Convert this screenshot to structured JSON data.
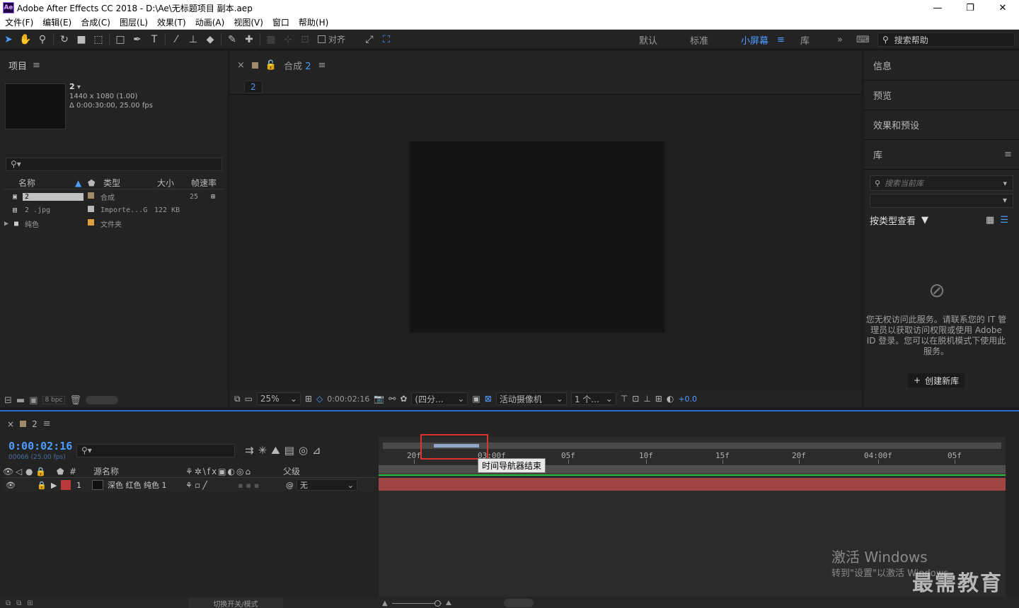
{
  "window": {
    "app_icon": "Ae",
    "title": "Adobe After Effects CC 2018 - D:\\Ae\\无标题项目 副本.aep",
    "minimize": "—",
    "maximize": "❐",
    "close": "✕"
  },
  "menu": [
    "文件(F)",
    "编辑(E)",
    "合成(C)",
    "图层(L)",
    "效果(T)",
    "动画(A)",
    "视图(V)",
    "窗口",
    "帮助(H)"
  ],
  "toolbar": {
    "align_label": "对齐",
    "workspaces": [
      "默认",
      "标准",
      "小屏幕",
      "库"
    ],
    "active_workspace": "小屏幕",
    "more": "»",
    "search_placeholder": "搜索帮助"
  },
  "project": {
    "title": "项目",
    "comp_name": "2",
    "comp_size": "1440 x 1080 (1.00)",
    "comp_duration": "Δ 0:00:30:00, 25.00 fps",
    "columns": [
      "名称",
      "类型",
      "大小",
      "帧速率"
    ],
    "items": [
      {
        "name": "2",
        "type": "合成",
        "size": "",
        "fps": "25",
        "color": "#a08a6a"
      },
      {
        "name": "2 .jpg",
        "type": "Importe...G",
        "size": "122 KB",
        "fps": "",
        "color": "#b8b8b8"
      },
      {
        "name": "纯色",
        "type": "文件夹",
        "size": "",
        "fps": "",
        "color": "#e0a040"
      }
    ],
    "bpc": "8 bpc"
  },
  "composition": {
    "tab_label": "合成",
    "tab_comp": "2",
    "breadcrumb": "2",
    "zoom": "25%",
    "time": "0:00:02:16",
    "resolution": "(四分...",
    "camera": "活动摄像机",
    "views": "1 个...",
    "exposure": "+0.0"
  },
  "right_panel": {
    "sections": [
      "信息",
      "预览",
      "效果和预设"
    ],
    "library_title": "库",
    "library_search_placeholder": "搜索当前库",
    "view_by": "按类型查看",
    "message": "您无权访问此服务。请联系您的 IT 管理员以获取访问权限或使用 Adobe ID 登录。您可以在脱机模式下使用此服务。",
    "create_library": "创建新库"
  },
  "timeline": {
    "tab_name": "2",
    "current_time": "0:00:02:16",
    "frames": "00066 (25.00 fps)",
    "columns": {
      "source_name": "源名称",
      "parent": "父级"
    },
    "layer": {
      "index": "1",
      "name": "深色 红色 纯色 1",
      "parent": "无"
    },
    "ruler_ticks": [
      "20f",
      "03:00f",
      "05f",
      "10f",
      "15f",
      "20f",
      "04:00f",
      "05f"
    ],
    "tooltip": "时间导航器结束",
    "toggle_label": "切换开关/模式"
  },
  "watermark": {
    "line1": "激活 Windows",
    "line2": "转到\"设置\"以激活 Windows。",
    "logo": "最需教育"
  },
  "colors": {
    "accent": "#4d9cff",
    "highlight": "#e03030",
    "layer": "#a04545"
  }
}
